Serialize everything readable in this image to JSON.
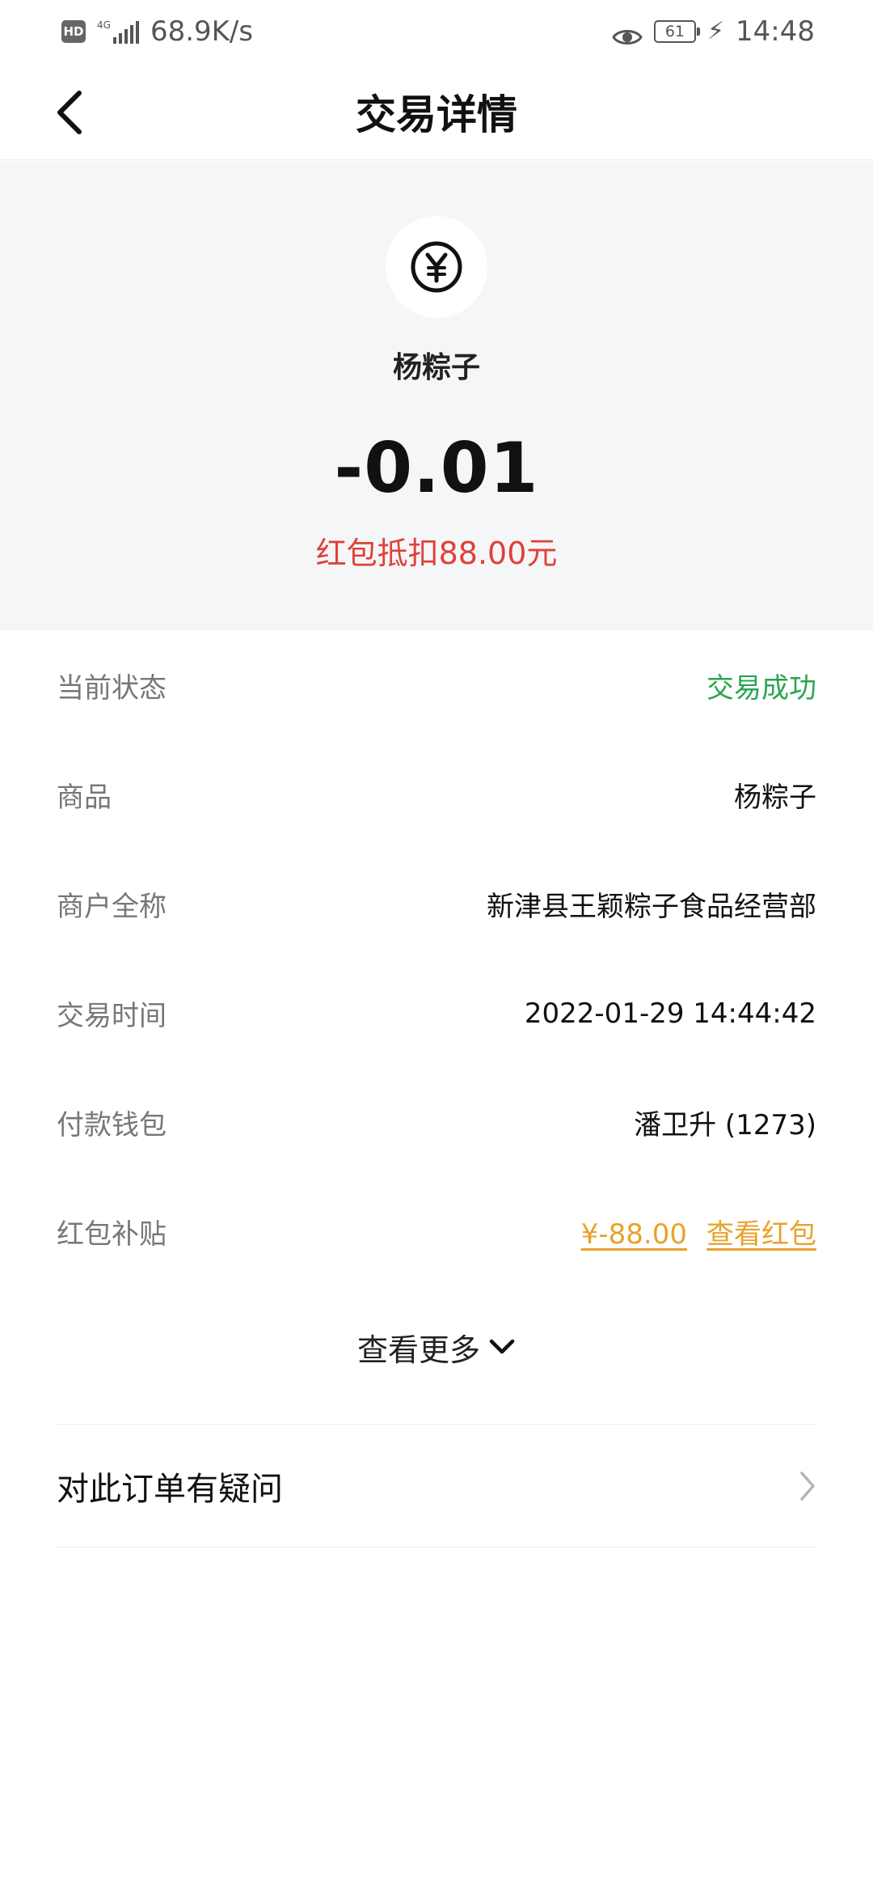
{
  "status_bar": {
    "network_speed": "68.9K/s",
    "network_type": "4G",
    "battery_level": "61",
    "time": "14:48"
  },
  "nav": {
    "title": "交易详情"
  },
  "summary": {
    "merchant_icon": "yuan-coin-icon",
    "merchant_name": "杨粽子",
    "amount": "-0.01",
    "discount_note": "红包抵扣88.00元"
  },
  "details": {
    "rows": [
      {
        "label": "当前状态",
        "value": "交易成功"
      },
      {
        "label": "商品",
        "value": "杨粽子"
      },
      {
        "label": "商户全称",
        "value": "新津县王颖粽子食品经营部"
      },
      {
        "label": "交易时间",
        "value": "2022-01-29 14:44:42"
      },
      {
        "label": "付款钱包",
        "value": "潘卫升 (1273)"
      },
      {
        "label": "红包补贴",
        "value": "¥-88.00",
        "link": "查看红包"
      }
    ]
  },
  "more": {
    "label": "查看更多"
  },
  "question": {
    "label": "对此订单有疑问"
  },
  "colors": {
    "success": "#2aa550",
    "discount": "#e0413a",
    "link": "#e8a22a",
    "summary_background": "#f5f6f8"
  }
}
